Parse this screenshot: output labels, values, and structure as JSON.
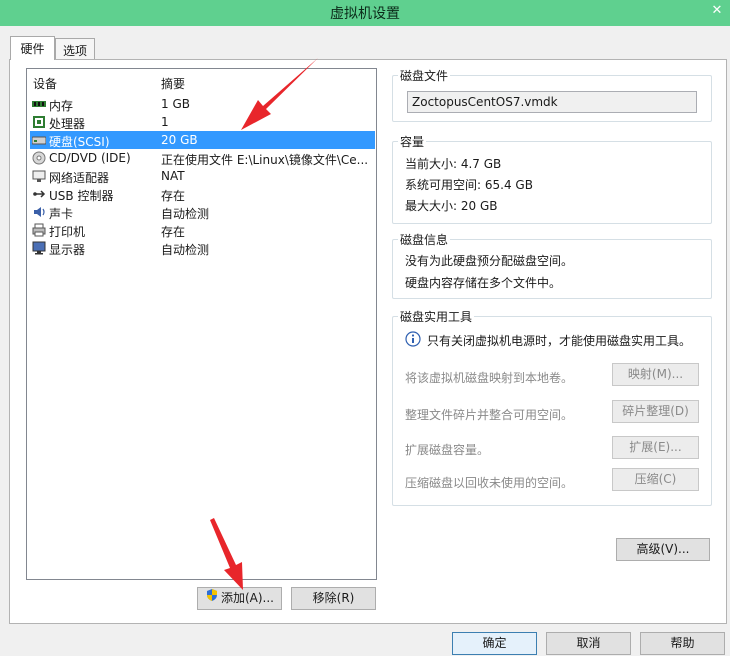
{
  "window": {
    "title": "虚拟机设置",
    "close_glyph": "✕"
  },
  "tabs": [
    {
      "label": "硬件",
      "active": true
    },
    {
      "label": "选项",
      "active": false
    }
  ],
  "device_list": {
    "headers": {
      "device": "设备",
      "summary": "摘要"
    },
    "rows": [
      {
        "icon": "memory-icon",
        "name": "内存",
        "summary": "1 GB",
        "selected": false
      },
      {
        "icon": "processor-icon",
        "name": "处理器",
        "summary": "1",
        "selected": false
      },
      {
        "icon": "hard-disk-icon",
        "name": "硬盘(SCSI)",
        "summary": "20 GB",
        "selected": true
      },
      {
        "icon": "cd-dvd-icon",
        "name": "CD/DVD (IDE)",
        "summary": "正在使用文件 E:\\Linux\\镜像文件\\Ce...",
        "selected": false
      },
      {
        "icon": "network-adapter-icon",
        "name": "网络适配器",
        "summary": "NAT",
        "selected": false
      },
      {
        "icon": "usb-icon",
        "name": "USB 控制器",
        "summary": "存在",
        "selected": false
      },
      {
        "icon": "sound-card-icon",
        "name": "声卡",
        "summary": "自动检测",
        "selected": false
      },
      {
        "icon": "printer-icon",
        "name": "打印机",
        "summary": "存在",
        "selected": false
      },
      {
        "icon": "display-icon",
        "name": "显示器",
        "summary": "自动检测",
        "selected": false
      }
    ]
  },
  "buttons": {
    "add": "添加(A)...",
    "remove": "移除(R)",
    "advanced": "高级(V)...",
    "ok": "确定",
    "cancel": "取消",
    "help": "帮助"
  },
  "disk_file": {
    "title": "磁盘文件",
    "value": "ZoctopusCentOS7.vmdk"
  },
  "capacity": {
    "title": "容量",
    "current_size": "当前大小: 4.7 GB",
    "system_free": "系统可用空间: 65.4 GB",
    "max_size": "最大大小: 20 GB"
  },
  "disk_info": {
    "title": "磁盘信息",
    "line1": "没有为此硬盘预分配磁盘空间。",
    "line2": "硬盘内容存储在多个文件中。"
  },
  "disk_utilities": {
    "title": "磁盘实用工具",
    "notice": "只有关闭虚拟机电源时，才能使用磁盘实用工具。",
    "items": [
      {
        "label": "将该虚拟机磁盘映射到本地卷。",
        "button": "映射(M)..."
      },
      {
        "label": "整理文件碎片并整合可用空间。",
        "button": "碎片整理(D)"
      },
      {
        "label": "扩展磁盘容量。",
        "button": "扩展(E)..."
      },
      {
        "label": "压缩磁盘以回收未使用的空间。",
        "button": "压缩(C)"
      }
    ]
  },
  "colors": {
    "selection": "#3399ff",
    "titlebar": "#5fd08f",
    "annotation_arrow": "#e8262b"
  }
}
